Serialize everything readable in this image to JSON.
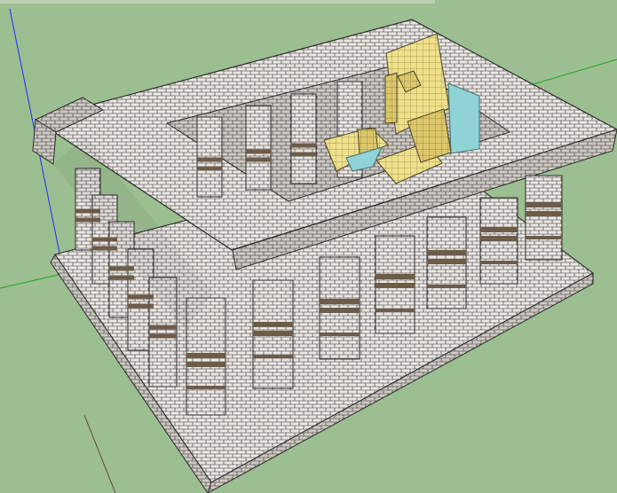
{
  "viewport": {
    "label": "",
    "background_color": "#9cbf91"
  },
  "model": {
    "name": "",
    "colors": {
      "stone": "#eae8e4",
      "stone_shadow": "#c7c4bf",
      "mortar": "#2b2b2b",
      "band": "#6d5c49",
      "statue": "#efe08a",
      "statue_shadow": "#d8c56c",
      "accent": "#8fd3d6"
    },
    "parts": {
      "base": "stylobate",
      "roof": "entablature",
      "front_columns": 7,
      "left_columns": 5,
      "back_columns": 4,
      "statue": "seated-statue"
    }
  },
  "axes": {
    "red": "#b03020",
    "green": "#19a51b",
    "blue": "#1f2dff"
  }
}
